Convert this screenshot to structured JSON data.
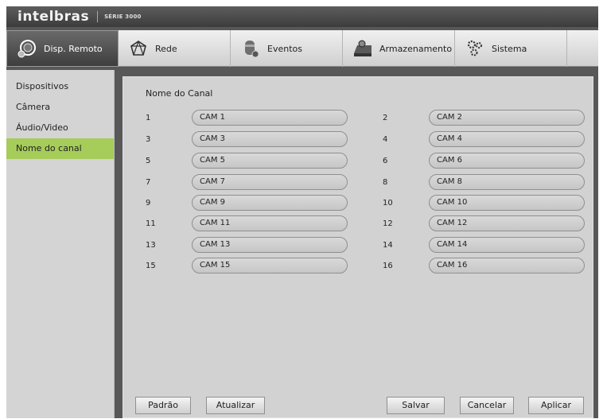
{
  "app": {
    "brand": "intelbras",
    "series": "SÉRIE 3000"
  },
  "tabs": [
    {
      "label": "Disp. Remoto",
      "icon": "remote-device-icon"
    },
    {
      "label": "Rede",
      "icon": "network-icon"
    },
    {
      "label": "Eventos",
      "icon": "events-icon"
    },
    {
      "label": "Armazenamento",
      "icon": "storage-icon"
    },
    {
      "label": "Sistema",
      "icon": "gears-icon"
    }
  ],
  "sidebar": {
    "items": [
      {
        "label": "Dispositivos"
      },
      {
        "label": "Câmera"
      },
      {
        "label": "Áudio/Video"
      },
      {
        "label": "Nome do canal"
      }
    ]
  },
  "main": {
    "title": "Nome do Canal",
    "channels": [
      {
        "num": "1",
        "name": "CAM 1"
      },
      {
        "num": "2",
        "name": "CAM 2"
      },
      {
        "num": "3",
        "name": "CAM 3"
      },
      {
        "num": "4",
        "name": "CAM 4"
      },
      {
        "num": "5",
        "name": "CAM 5"
      },
      {
        "num": "6",
        "name": "CAM 6"
      },
      {
        "num": "7",
        "name": "CAM 7"
      },
      {
        "num": "8",
        "name": "CAM 8"
      },
      {
        "num": "9",
        "name": "CAM 9"
      },
      {
        "num": "10",
        "name": "CAM 10"
      },
      {
        "num": "11",
        "name": "CAM 11"
      },
      {
        "num": "12",
        "name": "CAM 12"
      },
      {
        "num": "13",
        "name": "CAM 13"
      },
      {
        "num": "14",
        "name": "CAM 14"
      },
      {
        "num": "15",
        "name": "CAM 15"
      },
      {
        "num": "16",
        "name": "CAM 16"
      }
    ]
  },
  "buttons": {
    "default": "Padrão",
    "refresh": "Atualizar",
    "save": "Salvar",
    "cancel": "Cancelar",
    "apply": "Aplicar"
  },
  "colors": {
    "active_side": "#a6cc5a",
    "active_tab": "#4a4a4a"
  }
}
